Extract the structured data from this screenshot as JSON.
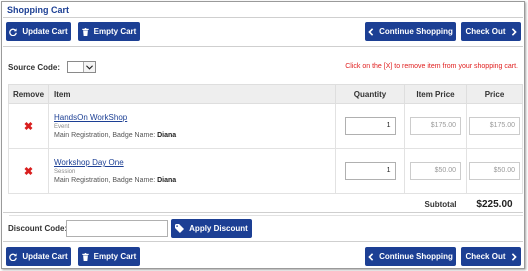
{
  "title": "Shopping Cart",
  "toolbar": {
    "update_label": "Update Cart",
    "empty_label": "Empty Cart",
    "continue_label": "Continue Shopping",
    "checkout_label": "Check Out"
  },
  "source_code": {
    "label": "Source Code:",
    "selected": ""
  },
  "remove_hint": "Click on the [X] to remove item from your shopping cart.",
  "table": {
    "headers": {
      "remove": "Remove",
      "item": "Item",
      "quantity": "Quantity",
      "item_price": "Item Price",
      "price": "Price"
    },
    "rows": [
      {
        "name": "HandsOn WorkShop",
        "type": "Event",
        "detail_prefix": "Main Registration, Badge Name:",
        "badge_name": "Diana",
        "quantity": "1",
        "item_price": "$175.00",
        "price": "$175.00"
      },
      {
        "name": "Workshop Day One",
        "type": "Session",
        "detail_prefix": "Main Registration, Badge Name:",
        "badge_name": "Diana",
        "quantity": "1",
        "item_price": "$50.00",
        "price": "$50.00"
      }
    ],
    "subtotal_label": "Subtotal",
    "subtotal_value": "$225.00"
  },
  "discount": {
    "label": "Discount Code:",
    "value": "",
    "apply_label": "Apply Discount"
  },
  "icons": {
    "update": "refresh-icon",
    "empty": "trash-icon",
    "continue": "chevron-left-icon",
    "checkout": "chevron-right-icon",
    "remove": "remove-x-icon",
    "apply": "tag-icon"
  },
  "colors": {
    "brand": "#1c3f94",
    "remove": "#d81e1e",
    "hint": "#e02020"
  }
}
